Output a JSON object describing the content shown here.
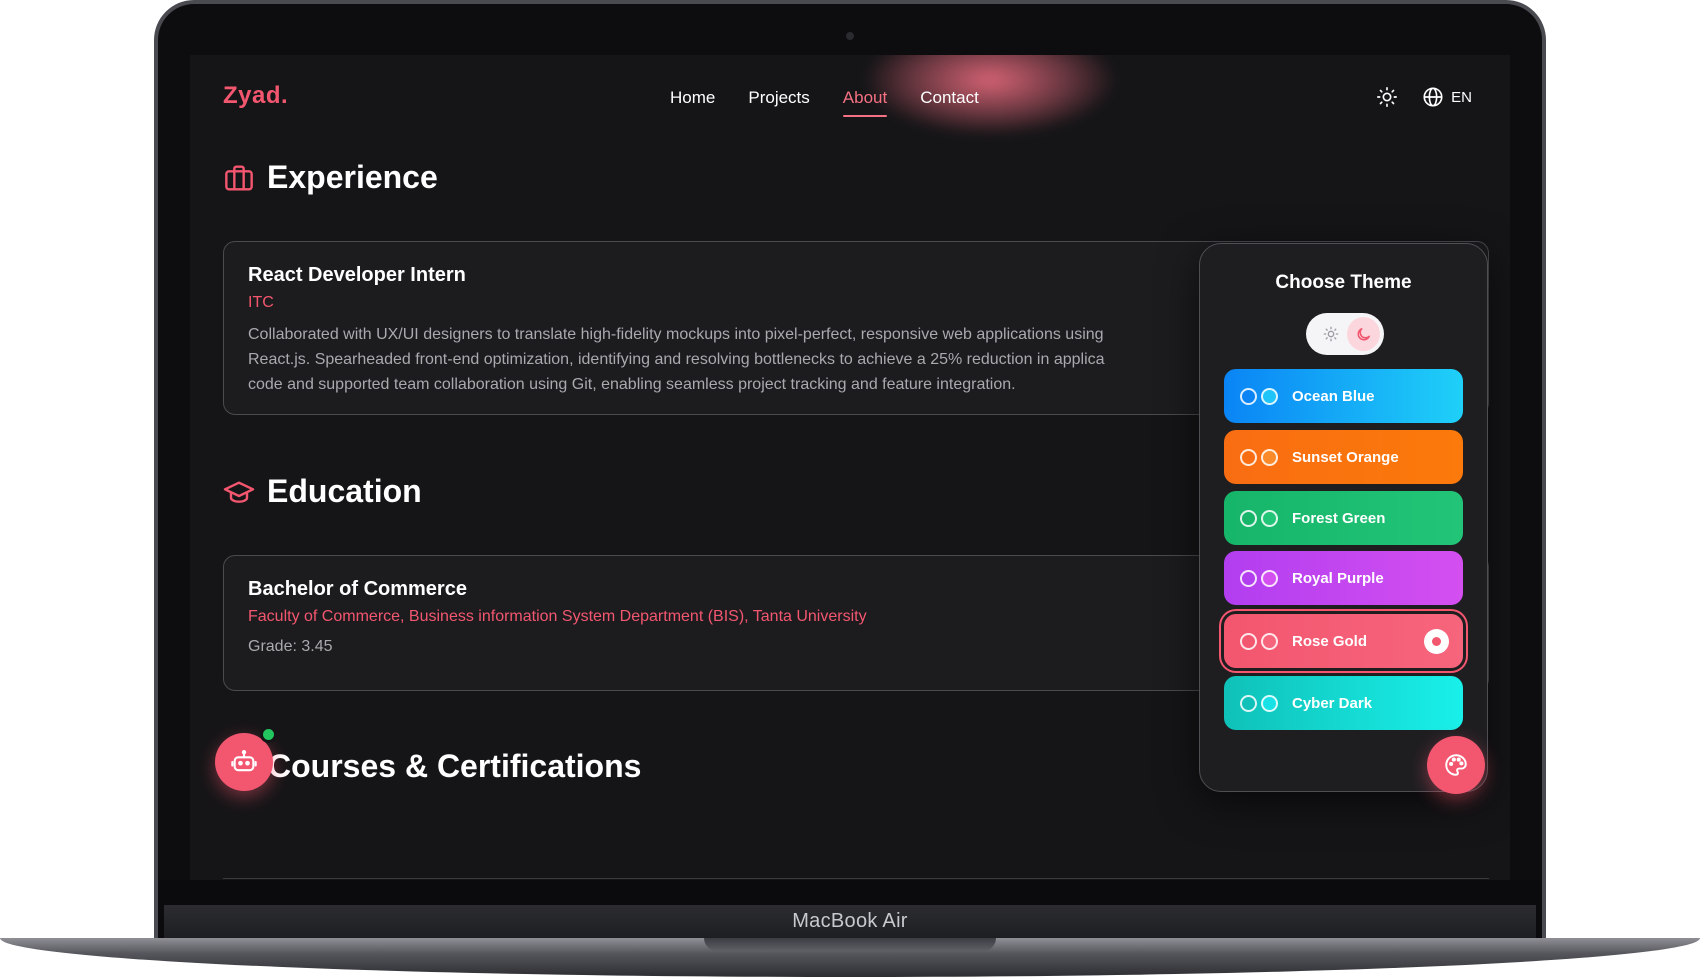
{
  "device": {
    "label": "MacBook Air"
  },
  "nav": {
    "logo": "Zyad.",
    "links": [
      {
        "label": "Home",
        "active": false
      },
      {
        "label": "Projects",
        "active": false
      },
      {
        "label": "About",
        "active": true
      },
      {
        "label": "Contact",
        "active": false
      }
    ],
    "theme_icon": "sun-icon",
    "language_icon": "globe-icon",
    "language": "EN"
  },
  "experience": {
    "title": "Experience",
    "icon": "briefcase-icon",
    "items": [
      {
        "role": "React Developer Intern",
        "company": "ITC",
        "description_lines": [
          "Collaborated with UX/UI designers to translate high-fidelity mockups into pixel-perfect, responsive web applications using",
          "React.js. Spearheaded front-end optimization, identifying and resolving bottlenecks to achieve a 25% reduction in applica",
          "code and supported team collaboration using Git, enabling seamless project tracking and feature integration."
        ]
      }
    ]
  },
  "education": {
    "title": "Education",
    "icon": "graduation-cap-icon",
    "items": [
      {
        "degree": "Bachelor of Commerce",
        "institution": "Faculty of Commerce, Business information System Department (BIS), Tanta University",
        "grade": "Grade: 3.45"
      }
    ]
  },
  "courses": {
    "title": "Courses & Certifications"
  },
  "theme_panel": {
    "title": "Choose Theme",
    "mode": "dark",
    "themes": [
      {
        "name": "Ocean Blue",
        "gradient": [
          "#0a84f5",
          "#1fd0f8"
        ],
        "dots": [
          "#0a84f5",
          "#1fc4f8"
        ],
        "selected": false
      },
      {
        "name": "Sunset Orange",
        "gradient": [
          "#f96d12",
          "#fb7a0b"
        ],
        "dots": [
          "#f96d12",
          "#fb8a2a"
        ],
        "selected": false
      },
      {
        "name": "Forest Green",
        "gradient": [
          "#16b56a",
          "#22c577"
        ],
        "dots": [
          "#16b56a",
          "#22c577"
        ],
        "selected": false
      },
      {
        "name": "Royal Purple",
        "gradient": [
          "#b23ef0",
          "#d44ff0"
        ],
        "dots": [
          "#b23ef0",
          "#d44ff0"
        ],
        "selected": false
      },
      {
        "name": "Rose Gold",
        "gradient": [
          "#f3566f",
          "#f6657c"
        ],
        "dots": [
          "#f3566f",
          "#f6657c"
        ],
        "selected": true
      },
      {
        "name": "Cyber Dark",
        "gradient": [
          "#0fc1b8",
          "#19f0ea"
        ],
        "dots": [
          "#0fc1b8",
          "#19e2e6"
        ],
        "selected": false
      }
    ]
  },
  "fabs": {
    "chat_icon": "robot-icon",
    "palette_icon": "palette-icon"
  },
  "colors": {
    "accent": "#f3566f",
    "background": "#151517",
    "card": "#1c1c1f",
    "online": "#22c55e"
  }
}
